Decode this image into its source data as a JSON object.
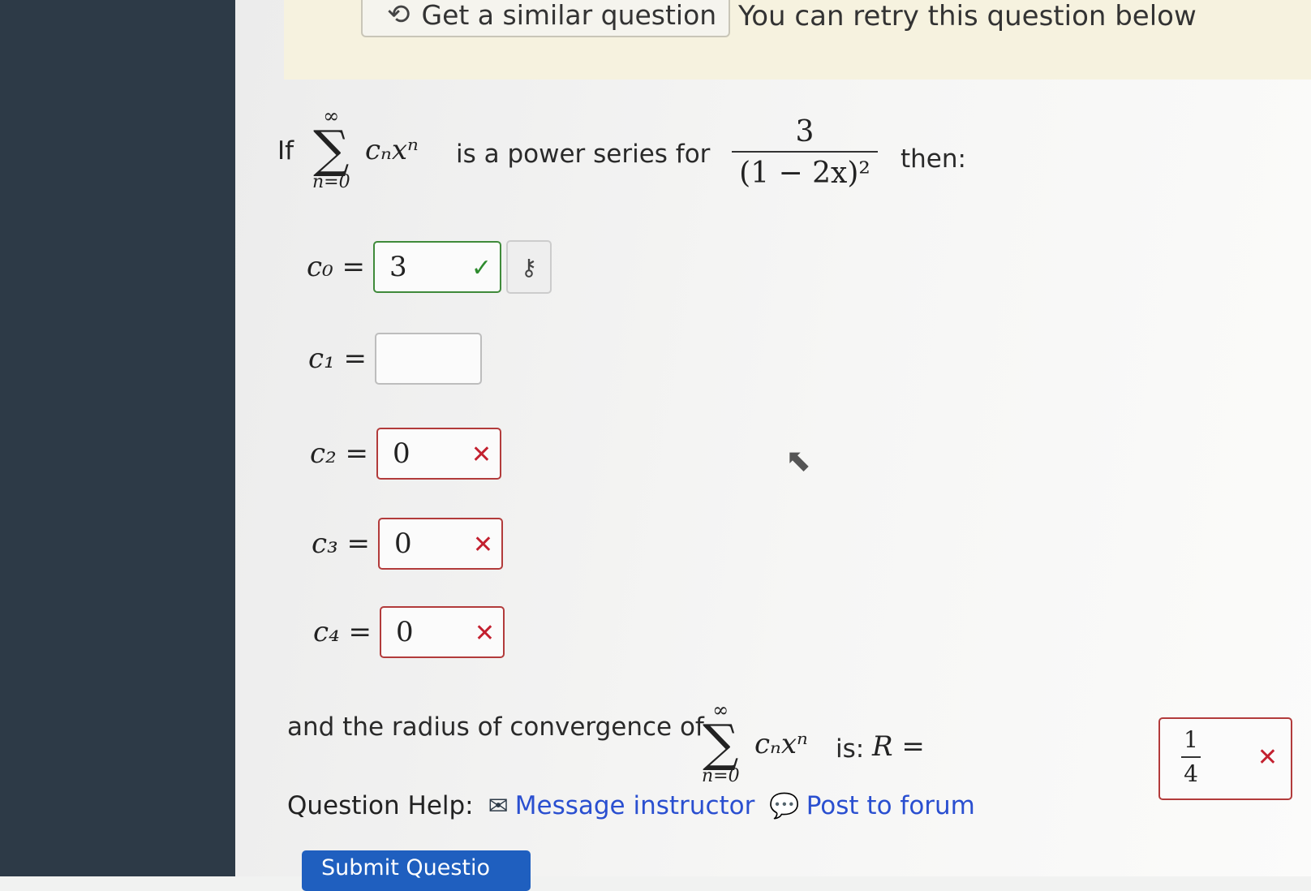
{
  "banner": {
    "similar_button_label": "Get a similar question",
    "similar_icon": "refresh-icon",
    "retry_text": "You can retry this question below"
  },
  "question": {
    "prefix": "If",
    "sum_upper": "∞",
    "sum_symbol": "∑",
    "sum_lower": "n=0",
    "term": "cₙxⁿ",
    "middle_text": "is a power series for",
    "fraction_numerator": "3",
    "fraction_denominator": "(1 − 2x)²",
    "suffix": "then:"
  },
  "coefficients": [
    {
      "label": "c₀ =",
      "value": "3",
      "status": "correct",
      "mark": "✓",
      "has_key_button": true,
      "key_icon": "key-icon"
    },
    {
      "label": "c₁ =",
      "value": "",
      "status": "empty",
      "mark": ""
    },
    {
      "label": "c₂ =",
      "value": "0",
      "status": "incorrect",
      "mark": "✕"
    },
    {
      "label": "c₃ =",
      "value": "0",
      "status": "incorrect",
      "mark": "✕"
    },
    {
      "label": "c₄ =",
      "value": "0",
      "status": "incorrect",
      "mark": "✕"
    }
  ],
  "radius": {
    "text": "and the radius of convergence of",
    "is_text": "is:",
    "R_label": "R =",
    "answer_numerator": "1",
    "answer_denominator": "4",
    "status": "incorrect",
    "mark": "✕"
  },
  "help": {
    "label": "Question Help:",
    "message_label": "Message instructor",
    "message_icon": "mail-icon",
    "forum_label": "Post to forum",
    "forum_icon": "chat-bubble-icon"
  },
  "submit_label": "Submit Questio",
  "colors": {
    "sidebar": "#2d3a47",
    "banner": "#f6f2df",
    "correct": "#2e8b2e",
    "incorrect": "#c3202f",
    "link": "#2a4fd0",
    "submit": "#1f5fbf"
  }
}
